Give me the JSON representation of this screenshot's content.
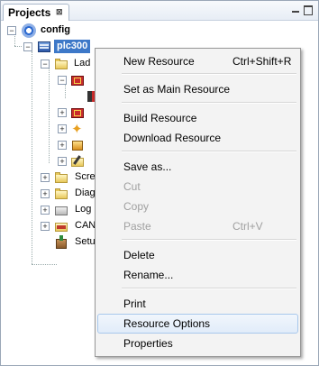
{
  "panel": {
    "tab_label": "Projects",
    "tab_close": "⊠"
  },
  "tree": {
    "config": "config",
    "plc": "plc300",
    "ladder": "Lad",
    "screens": "Scre",
    "diagnostics": "Diag",
    "log": "Log",
    "can": "CAN",
    "setup": "Setu"
  },
  "menu": {
    "items": [
      {
        "label": "New Resource",
        "shortcut": "Ctrl+Shift+R",
        "enabled": true
      },
      {
        "label": "Set as Main Resource",
        "shortcut": "",
        "enabled": true
      },
      {
        "label": "Build Resource",
        "shortcut": "",
        "enabled": true
      },
      {
        "label": "Download Resource",
        "shortcut": "",
        "enabled": true
      },
      {
        "label": "Save as...",
        "shortcut": "",
        "enabled": true
      },
      {
        "label": "Cut",
        "shortcut": "",
        "enabled": false
      },
      {
        "label": "Copy",
        "shortcut": "",
        "enabled": false
      },
      {
        "label": "Paste",
        "shortcut": "Ctrl+V",
        "enabled": false
      },
      {
        "label": "Delete",
        "shortcut": "",
        "enabled": true
      },
      {
        "label": "Rename...",
        "shortcut": "",
        "enabled": true
      },
      {
        "label": "Print",
        "shortcut": "",
        "enabled": true
      },
      {
        "label": "Resource Options",
        "shortcut": "",
        "enabled": true,
        "hovered": true
      },
      {
        "label": "Properties",
        "shortcut": "",
        "enabled": true
      }
    ]
  }
}
